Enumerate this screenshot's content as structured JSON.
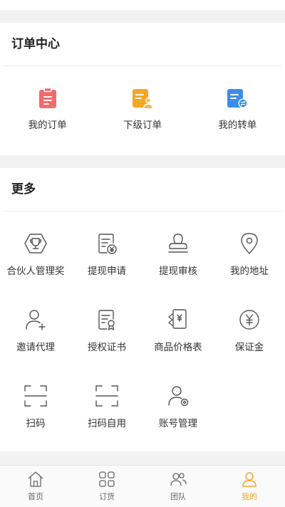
{
  "order_center": {
    "title": "订单中心",
    "items": [
      {
        "label": "我的订单",
        "icon": "clipboard-icon",
        "color": "#f26b6b"
      },
      {
        "label": "下级订单",
        "icon": "subordinate-order-icon",
        "color": "#f5a623"
      },
      {
        "label": "我的转单",
        "icon": "transfer-order-icon",
        "color": "#3a8ee6"
      }
    ]
  },
  "more": {
    "title": "更多",
    "items": [
      {
        "label": "合伙人管理奖",
        "icon": "trophy-icon"
      },
      {
        "label": "提现申请",
        "icon": "withdraw-apply-icon"
      },
      {
        "label": "提现审核",
        "icon": "stamp-icon"
      },
      {
        "label": "我的地址",
        "icon": "location-pin-icon"
      },
      {
        "label": "邀请代理",
        "icon": "add-user-icon"
      },
      {
        "label": "授权证书",
        "icon": "certificate-icon"
      },
      {
        "label": "商品价格表",
        "icon": "price-list-icon"
      },
      {
        "label": "保证金",
        "icon": "yen-circle-icon"
      },
      {
        "label": "扫码",
        "icon": "scan-icon"
      },
      {
        "label": "扫码自用",
        "icon": "scan-self-icon"
      },
      {
        "label": "账号管理",
        "icon": "account-settings-icon"
      }
    ]
  },
  "tabbar": {
    "active_color": "#f5a623",
    "items": [
      {
        "label": "首页",
        "icon": "home-icon",
        "active": false
      },
      {
        "label": "订货",
        "icon": "grid-icon",
        "active": false
      },
      {
        "label": "团队",
        "icon": "team-icon",
        "active": false
      },
      {
        "label": "我的",
        "icon": "person-icon",
        "active": true
      }
    ]
  }
}
